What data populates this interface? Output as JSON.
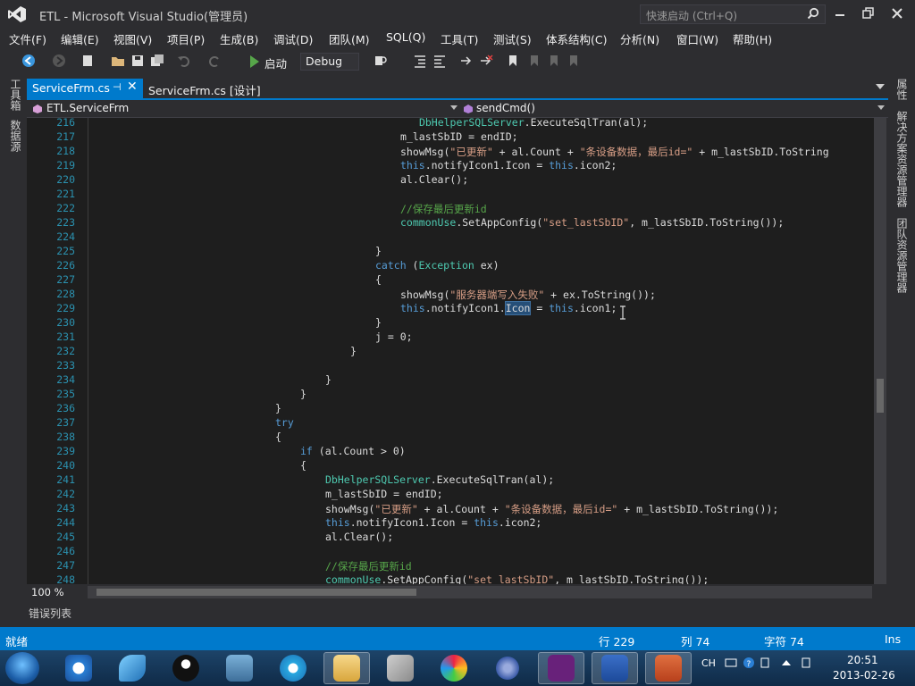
{
  "window": {
    "title": "ETL - Microsoft Visual Studio(管理员)",
    "quick_launch_placeholder": "快速启动 (Ctrl+Q)"
  },
  "menu": [
    "文件(F)",
    "编辑(E)",
    "视图(V)",
    "项目(P)",
    "生成(B)",
    "调试(D)",
    "团队(M)",
    "SQL(Q)",
    "工具(T)",
    "测试(S)",
    "体系结构(C)",
    "分析(N)",
    "窗口(W)",
    "帮助(H)"
  ],
  "toolbar": {
    "start_label": "启动",
    "config_value": "Debug"
  },
  "left_tabs": [
    "工具箱",
    "数据源"
  ],
  "right_tabs": [
    "属性",
    "解决方案资源管理器",
    "团队资源管理器"
  ],
  "doc_tabs": {
    "active": "ServiceFrm.cs",
    "pin": "⊣",
    "close": "✕",
    "second": "ServiceFrm.cs [设计]"
  },
  "nav": {
    "class": "ETL.ServiceFrm",
    "member": "sendCmd()"
  },
  "editor": {
    "line_numbers": [
      "216",
      "217",
      "218",
      "219",
      "220",
      "221",
      "222",
      "223",
      "224",
      "225",
      "226",
      "227",
      "228",
      "229",
      "230",
      "231",
      "232",
      "233",
      "234",
      "235",
      "236",
      "237",
      "238",
      "239",
      "240",
      "241",
      "242",
      "243",
      "244",
      "245",
      "246",
      "247",
      "248"
    ],
    "lines": [
      [
        [
          28,
          " ",
          ""
        ],
        [
          0,
          "DbHelperSQLServer",
          "ty"
        ],
        [
          0,
          ".ExecuteSqlTran(al);",
          ""
        ]
      ],
      [
        [
          27,
          "",
          ""
        ],
        [
          0,
          "m_lastSbID = endID;",
          ""
        ]
      ],
      [
        [
          27,
          "",
          ""
        ],
        [
          0,
          "showMsg(",
          ""
        ],
        [
          0,
          "\"已更新\"",
          "st"
        ],
        [
          0,
          " + al.Count + ",
          ""
        ],
        [
          0,
          "\"条设备数据，最后id=\"",
          "st"
        ],
        [
          0,
          " + m_lastSbID.ToString",
          ""
        ]
      ],
      [
        [
          27,
          "",
          ""
        ],
        [
          0,
          "this",
          "kw"
        ],
        [
          0,
          ".notifyIcon1.Icon = ",
          ""
        ],
        [
          0,
          "this",
          "kw"
        ],
        [
          0,
          ".icon2;",
          ""
        ]
      ],
      [
        [
          27,
          "",
          ""
        ],
        [
          0,
          "al.Clear();",
          ""
        ]
      ],
      [
        [
          0,
          "",
          ""
        ]
      ],
      [
        [
          27,
          "",
          ""
        ],
        [
          0,
          "//保存最后更新id",
          "cm"
        ]
      ],
      [
        [
          27,
          "",
          ""
        ],
        [
          0,
          "commonUse",
          "ty"
        ],
        [
          0,
          ".SetAppConfig(",
          ""
        ],
        [
          0,
          "\"set_lastSbID\"",
          "st"
        ],
        [
          0,
          ", m_lastSbID.ToString());",
          ""
        ]
      ],
      [
        [
          0,
          "",
          ""
        ]
      ],
      [
        [
          25,
          "",
          ""
        ],
        [
          0,
          "}",
          ""
        ]
      ],
      [
        [
          25,
          "",
          ""
        ],
        [
          0,
          "catch",
          "kw"
        ],
        [
          0,
          " (",
          ""
        ],
        [
          0,
          "Exception",
          "ty"
        ],
        [
          0,
          " ex)",
          ""
        ]
      ],
      [
        [
          25,
          "",
          ""
        ],
        [
          0,
          "{",
          ""
        ]
      ],
      [
        [
          27,
          "",
          ""
        ],
        [
          0,
          "showMsg(",
          ""
        ],
        [
          0,
          "\"服务器端写入失败\"",
          "st"
        ],
        [
          0,
          " + ex.ToString());",
          ""
        ]
      ],
      [
        [
          27,
          "",
          ""
        ],
        [
          0,
          "this",
          "kw"
        ],
        [
          0,
          ".notifyIcon1.",
          ""
        ],
        [
          0,
          "Icon",
          "hl"
        ],
        [
          0,
          " = ",
          ""
        ],
        [
          0,
          "this",
          "kw"
        ],
        [
          0,
          ".icon1;",
          ""
        ]
      ],
      [
        [
          25,
          "",
          ""
        ],
        [
          0,
          "}",
          ""
        ]
      ],
      [
        [
          25,
          "",
          ""
        ],
        [
          0,
          "j = 0;",
          ""
        ]
      ],
      [
        [
          23,
          "",
          ""
        ],
        [
          0,
          "}",
          ""
        ]
      ],
      [
        [
          0,
          "",
          ""
        ]
      ],
      [
        [
          21,
          "",
          ""
        ],
        [
          0,
          "}",
          ""
        ]
      ],
      [
        [
          19,
          "",
          ""
        ],
        [
          0,
          "}",
          ""
        ]
      ],
      [
        [
          17,
          "",
          ""
        ],
        [
          0,
          "}",
          ""
        ]
      ],
      [
        [
          17,
          "",
          ""
        ],
        [
          0,
          "try",
          "kw"
        ]
      ],
      [
        [
          17,
          "",
          ""
        ],
        [
          0,
          "{",
          ""
        ]
      ],
      [
        [
          19,
          "",
          ""
        ],
        [
          0,
          "if",
          "kw"
        ],
        [
          0,
          " (al.Count > 0)",
          ""
        ]
      ],
      [
        [
          19,
          "",
          ""
        ],
        [
          0,
          "{",
          ""
        ]
      ],
      [
        [
          21,
          "",
          ""
        ],
        [
          0,
          "DbHelperSQLServer",
          "ty"
        ],
        [
          0,
          ".ExecuteSqlTran(al);",
          ""
        ]
      ],
      [
        [
          21,
          "",
          ""
        ],
        [
          0,
          "m_lastSbID = endID;",
          ""
        ]
      ],
      [
        [
          21,
          "",
          ""
        ],
        [
          0,
          "showMsg(",
          ""
        ],
        [
          0,
          "\"已更新\"",
          "st"
        ],
        [
          0,
          " + al.Count + ",
          ""
        ],
        [
          0,
          "\"条设备数据，最后id=\"",
          "st"
        ],
        [
          0,
          " + m_lastSbID.ToString());",
          ""
        ]
      ],
      [
        [
          21,
          "",
          ""
        ],
        [
          0,
          "this",
          "kw"
        ],
        [
          0,
          ".notifyIcon1.Icon = ",
          ""
        ],
        [
          0,
          "this",
          "kw"
        ],
        [
          0,
          ".icon2;",
          ""
        ]
      ],
      [
        [
          21,
          "",
          ""
        ],
        [
          0,
          "al.Clear();",
          ""
        ]
      ],
      [
        [
          0,
          "",
          ""
        ]
      ],
      [
        [
          21,
          "",
          ""
        ],
        [
          0,
          "//保存最后更新id",
          "cm"
        ]
      ],
      [
        [
          21,
          "",
          ""
        ],
        [
          0,
          "commonUse",
          "ty"
        ],
        [
          0,
          ".SetAppConfig(",
          ""
        ],
        [
          0,
          "\"set_lastSbID\"",
          "st"
        ],
        [
          0,
          ", m_lastSbID.ToString());",
          ""
        ]
      ]
    ],
    "zoom": "100 %"
  },
  "error_list": {
    "label": "错误列表"
  },
  "status": {
    "ready": "就绪",
    "line": "行 229",
    "col": "列 74",
    "char": "字符 74",
    "mode": "Ins"
  },
  "tray": {
    "lang": "CH",
    "time": "20:51",
    "date": "2013-02-26"
  },
  "taskbar_apps": [
    "start-orb",
    "pptv",
    "feiq",
    "qq",
    "network-tool",
    "ie",
    "explorer",
    "tool",
    "app-swirl",
    "infinity-app",
    "visual-studio",
    "word",
    "powerpoint"
  ],
  "colors": {
    "accent": "#007acc",
    "editor_bg": "#1e1e1e",
    "keyword": "#569cd6",
    "type": "#4ec9b0",
    "string": "#d69d85",
    "comment": "#57a64a"
  }
}
